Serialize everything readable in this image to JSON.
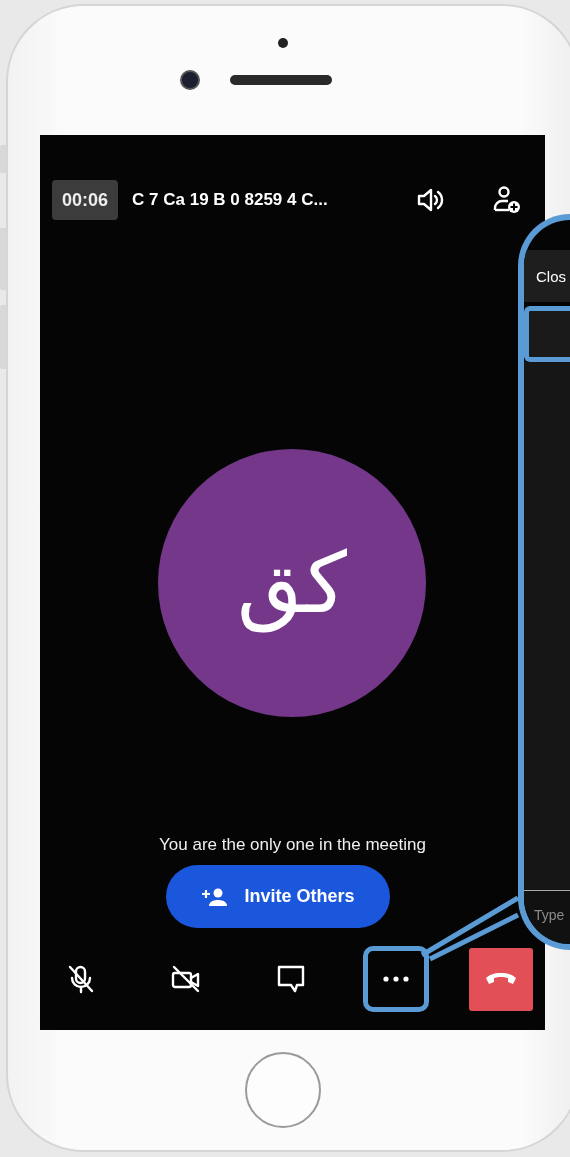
{
  "call": {
    "timer": "00:06",
    "title": "C 7 Ca 19 B 0 8259 4 C..."
  },
  "avatar": {
    "initials": "كق"
  },
  "message": "You are the only one in the meeting",
  "invite_button": {
    "label": "Invite Others"
  },
  "toolbar": [
    {
      "kind": "mic-off",
      "highlighted": false
    },
    {
      "kind": "camera-off",
      "highlighted": false
    },
    {
      "kind": "chat",
      "highlighted": false
    },
    {
      "kind": "more",
      "highlighted": true
    },
    {
      "kind": "hang-up",
      "highlighted": false
    }
  ],
  "callout": {
    "close_label": "Clos",
    "input_placeholder": "Type"
  }
}
